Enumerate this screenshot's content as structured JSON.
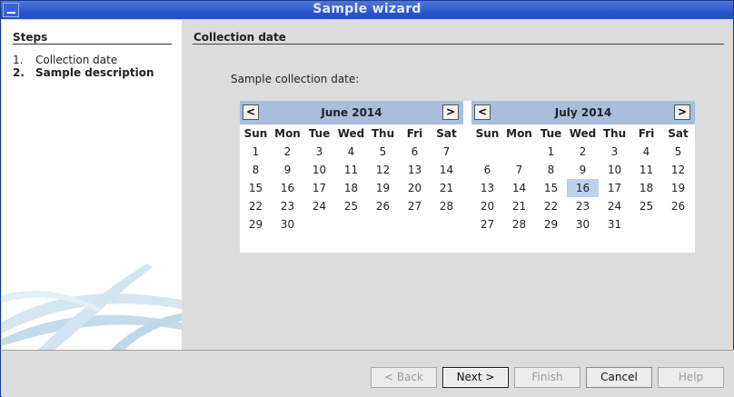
{
  "window": {
    "title": "Sample wizard"
  },
  "steps": {
    "heading": "Steps",
    "items": [
      {
        "num": "1.",
        "label": "Collection date",
        "current": false
      },
      {
        "num": "2.",
        "label": "Sample description",
        "current": true
      }
    ]
  },
  "page": {
    "heading": "Collection date",
    "prompt": "Sample collection date:"
  },
  "calendars": {
    "weekdays": [
      "Sun",
      "Mon",
      "Tue",
      "Wed",
      "Thu",
      "Fri",
      "Sat"
    ],
    "prev_label": "<",
    "next_label": ">",
    "left": {
      "month": "June 2014",
      "weeks": [
        [
          "1",
          "2",
          "3",
          "4",
          "5",
          "6",
          "7"
        ],
        [
          "8",
          "9",
          "10",
          "11",
          "12",
          "13",
          "14"
        ],
        [
          "15",
          "16",
          "17",
          "18",
          "19",
          "20",
          "21"
        ],
        [
          "22",
          "23",
          "24",
          "25",
          "26",
          "27",
          "28"
        ],
        [
          "29",
          "30",
          "",
          "",
          "",
          "",
          ""
        ]
      ]
    },
    "right": {
      "month": "July 2014",
      "selected": "16",
      "weeks": [
        [
          "",
          "",
          "1",
          "2",
          "3",
          "4",
          "5"
        ],
        [
          "6",
          "7",
          "8",
          "9",
          "10",
          "11",
          "12"
        ],
        [
          "13",
          "14",
          "15",
          "16",
          "17",
          "18",
          "19"
        ],
        [
          "20",
          "21",
          "22",
          "23",
          "24",
          "25",
          "26"
        ],
        [
          "27",
          "28",
          "29",
          "30",
          "31",
          "",
          ""
        ]
      ]
    }
  },
  "buttons": {
    "back": "< Back",
    "next": "Next >",
    "finish": "Finish",
    "cancel": "Cancel",
    "help": "Help"
  }
}
